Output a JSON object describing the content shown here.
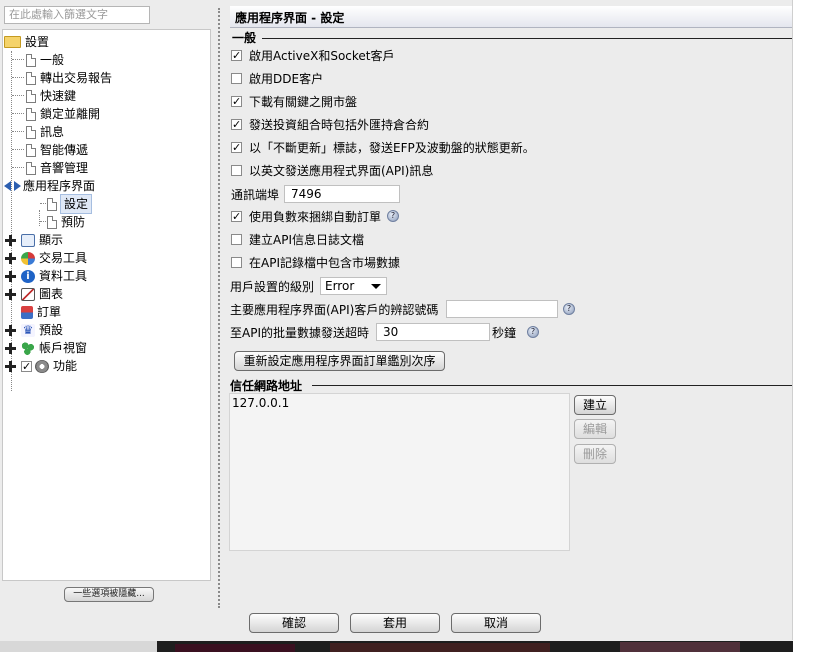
{
  "search": {
    "placeholder": "在此處輸入篩選文字"
  },
  "tree": {
    "root_label": "設置",
    "settings_children": [
      "一般",
      "轉出交易報告",
      "快速鍵",
      "鎖定並離開",
      "訊息",
      "智能傳遞",
      "音響管理"
    ],
    "api_label": "應用程序界面",
    "api_children": [
      "設定",
      "預防"
    ],
    "top_items": [
      "顯示",
      "交易工具",
      "資料工具",
      "圖表",
      "訂單",
      "預設",
      "帳戶視窗",
      "功能"
    ]
  },
  "more_options_button": "一些選項被隱藏...",
  "panel": {
    "title": "應用程序界面 - 設定",
    "general_section": "一般",
    "checkboxes": [
      {
        "label": "啟用ActiveX和Socket客戶",
        "checked": true
      },
      {
        "label": "啟用DDE客户",
        "checked": false
      },
      {
        "label": "下載有關鍵之開市盤",
        "checked": true
      },
      {
        "label": "發送投資組合時包括外匯持倉合約",
        "checked": true
      },
      {
        "label": "以「不斷更新」標誌，發送EFP及波動盤的狀態更新。",
        "checked": true
      },
      {
        "label": "以英文發送應用程式界面(API)訊息",
        "checked": false
      }
    ],
    "socket_port_label": "通訊端埠",
    "socket_port_value": "7496",
    "checkboxes2": [
      {
        "label": "使用負數來捆綁自動訂單",
        "checked": true
      },
      {
        "label": "建立API信息日誌文檔",
        "checked": false
      },
      {
        "label": "在API記錄檔中包含市場數據",
        "checked": false
      }
    ],
    "log_level_label": "用戶設置的級別",
    "log_level_value": "Error",
    "master_client_label": "主要應用程序界面(API)客戶的辨認號碼",
    "master_client_value": "",
    "timeout_label": "至API的批量數據發送超時",
    "timeout_value": "30",
    "timeout_unit": "秒鐘",
    "reset_button": "重新設定應用程序界面訂單鑑別次序",
    "trusted_section": "信任網路地址",
    "trusted_ips": [
      "127.0.0.1"
    ],
    "create_button": "建立",
    "edit_button": "編輯",
    "delete_button": "刪除"
  },
  "footer": {
    "ok": "確認",
    "apply": "套用",
    "cancel": "取消"
  }
}
